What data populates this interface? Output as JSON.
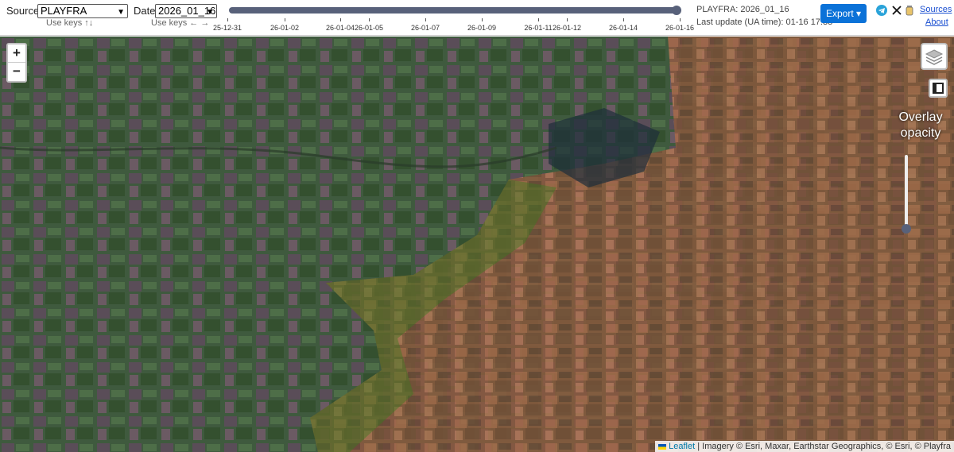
{
  "controls": {
    "source_label": "Source",
    "source_value": "PLAYFRA",
    "source_hint": "Use keys ↑↓",
    "date_label": "Date",
    "date_value": "2026_01_16",
    "date_hint": "Use keys ← →"
  },
  "timeline": {
    "ticks": [
      "25-12-31",
      "26-01-02",
      "26-01-04",
      "26-01-05",
      "26-01-07",
      "26-01-09",
      "26-01-11",
      "26-01-12",
      "26-01-14",
      "26-01-16"
    ],
    "selected": "26-01-16"
  },
  "info": {
    "current": "PLAYFRA: 2026_01_16",
    "last_update": "Last update (UA time): 01-16 17:38"
  },
  "export_label": "Export",
  "links": {
    "sources": "Sources",
    "about": "About"
  },
  "social": [
    "telegram-icon",
    "x-icon",
    "donate-jar-icon"
  ],
  "map": {
    "zoom_in": "+",
    "zoom_out": "−",
    "overlay_title": "Overlay opacity",
    "attribution_leaflet": "Leaflet",
    "attribution_rest": " | Imagery © Esri, Maxar, Earthstar Geographics, © Esri, © Playfra"
  },
  "colors": {
    "accent": "#0b72d8",
    "timeline": "#58617a",
    "overlay_red": "#c0643c",
    "overlay_green": "#3c7a1e",
    "overlay_blue": "#3a4a8a"
  }
}
